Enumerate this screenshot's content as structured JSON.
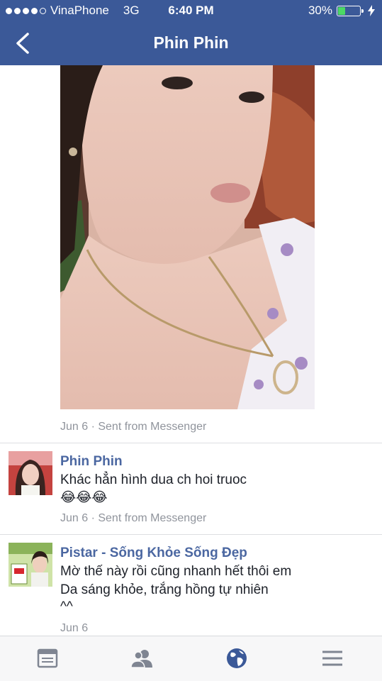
{
  "status_bar": {
    "carrier": "VinaPhone",
    "network": "3G",
    "time": "6:40 PM",
    "battery_percent": "30%",
    "battery_level": 0.3
  },
  "nav": {
    "title": "Phin Phin",
    "back_icon": "chevron-left-icon"
  },
  "post": {
    "photo_alt": "Selfie photo",
    "meta": "Jun 6 · Sent from Messenger"
  },
  "comments": [
    {
      "author": "Phin Phin",
      "text": "Khác hẳn hình dua ch hoi truoc",
      "emoji": "😂😂😂",
      "meta": "Jun 6 · Sent from Messenger"
    },
    {
      "author": "Pistar - Sống Khỏe Sống Đẹp",
      "line1": "Mờ thế này rồi cũng nhanh hết thôi em",
      "line2": "Da sáng khỏe, trắng hồng tự nhiên",
      "line3": "^^",
      "meta": "Jun 6"
    }
  ],
  "tabbar": {
    "tabs": [
      {
        "icon": "news-feed-icon",
        "active": false
      },
      {
        "icon": "friends-icon",
        "active": false
      },
      {
        "icon": "globe-icon",
        "active": true
      },
      {
        "icon": "menu-icon",
        "active": false
      }
    ],
    "active_color": "#3b5998",
    "inactive_color": "#7f8592"
  },
  "colors": {
    "brand": "#3b5998",
    "link_name": "#4b67a1",
    "meta": "#90949c"
  }
}
